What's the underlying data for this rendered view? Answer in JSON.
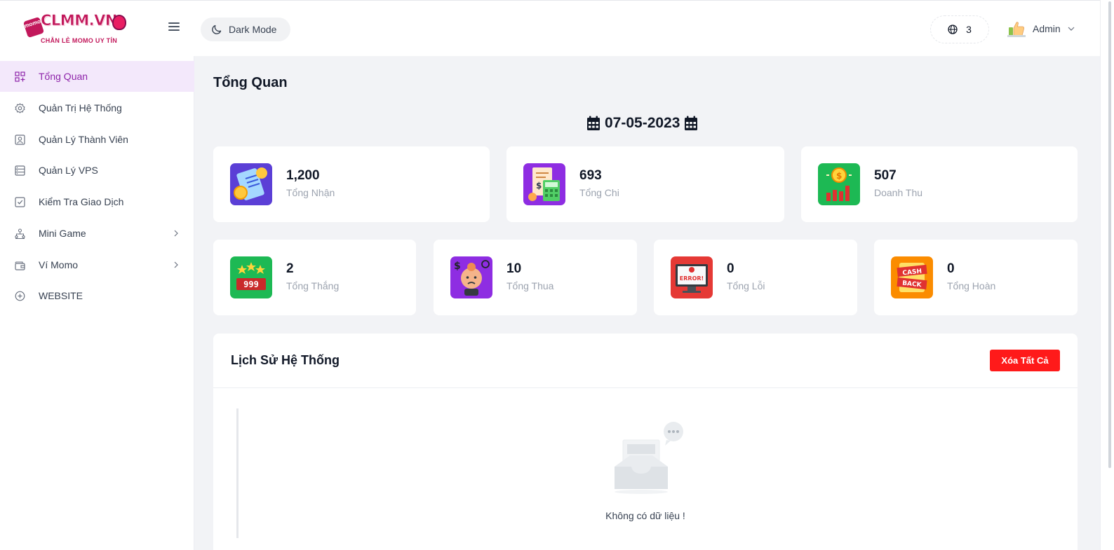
{
  "brand": {
    "name": "CLMM.VN",
    "badge": "momo",
    "tagline": "CHẴN LẺ MOMO UY TÍN",
    "accent": "#c2185b"
  },
  "header": {
    "dark_mode_label": "Dark Mode",
    "notification_count": "3",
    "user_name": "Admin"
  },
  "sidebar": {
    "items": [
      {
        "label": "Tổng Quan",
        "icon": "dashboard-icon",
        "active": true
      },
      {
        "label": "Quản Trị Hệ Thống",
        "icon": "gear-icon"
      },
      {
        "label": "Quản Lý Thành Viên",
        "icon": "user-card-icon"
      },
      {
        "label": "Quản Lý VPS",
        "icon": "server-icon"
      },
      {
        "label": "Kiểm Tra Giao Dịch",
        "icon": "checkbox-icon"
      },
      {
        "label": "Mini Game",
        "icon": "network-icon",
        "has_submenu": true
      },
      {
        "label": "Ví Momo",
        "icon": "wallet-icon",
        "has_submenu": true
      },
      {
        "label": "WEBSITE",
        "icon": "circle-plus-icon"
      }
    ],
    "active_bg": "#f3e8fb",
    "active_color": "#8e24aa"
  },
  "main": {
    "title": "Tổng Quan",
    "date": "07-05-2023",
    "stats_top": [
      {
        "value": "1,200",
        "label": "Tổng Nhận",
        "icon": "receipt-coin-icon",
        "color": "#5b3fd6"
      },
      {
        "value": "693",
        "label": "Tổng Chi",
        "icon": "bill-calculator-icon",
        "color": "#8e2de2"
      },
      {
        "value": "507",
        "label": "Doanh Thu",
        "icon": "revenue-chart-icon",
        "color": "#1db954"
      }
    ],
    "stats_bottom": [
      {
        "value": "2",
        "label": "Tổng Thắng",
        "icon": "jackpot-999-icon",
        "color": "#1db954"
      },
      {
        "value": "10",
        "label": "Tổng Thua",
        "icon": "sad-face-icon",
        "color": "#8e2de2"
      },
      {
        "value": "0",
        "label": "Tổng Lỗi",
        "icon": "error-monitor-icon",
        "color": "#e53935"
      },
      {
        "value": "0",
        "label": "Tổng Hoàn",
        "icon": "cashback-icon",
        "color": "#fb8c00"
      }
    ]
  },
  "history": {
    "title": "Lịch Sử Hệ Thống",
    "clear_label": "Xóa Tất Cả",
    "empty_text": "Không có dữ liệu !",
    "cashback_line1": "CASH",
    "cashback_line2": "BACK",
    "error_word": "ERROR!",
    "jackpot_digits": "999"
  }
}
